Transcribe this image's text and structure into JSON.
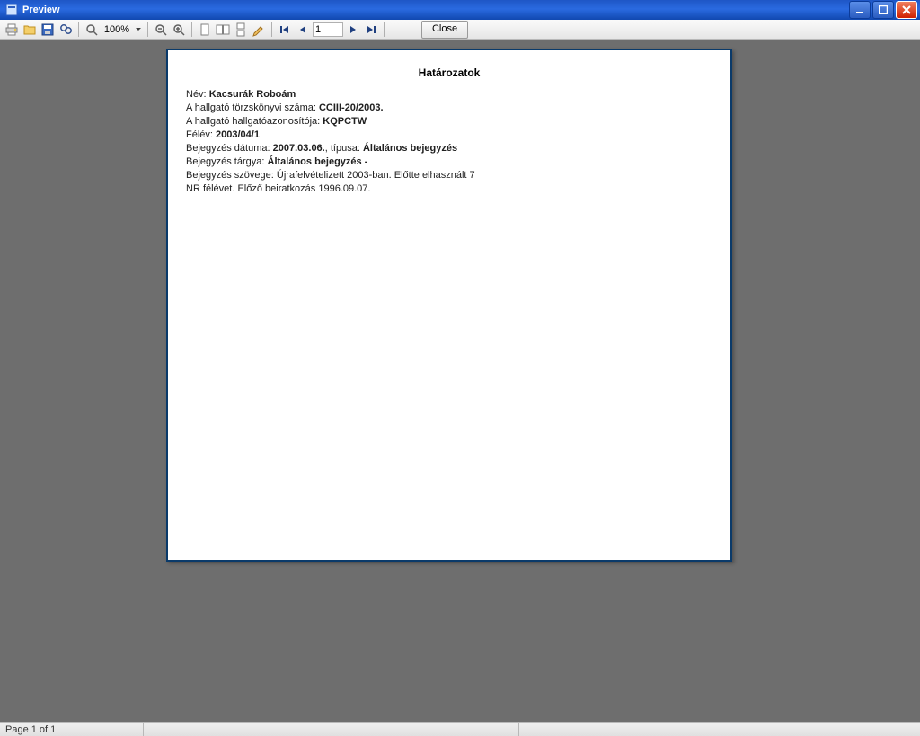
{
  "window": {
    "title": "Preview"
  },
  "toolbar": {
    "zoom_text": "100%",
    "page_input": "1",
    "close_label": "Close"
  },
  "document": {
    "heading": "Határozatok",
    "name_label": "Név:",
    "name_value": "Kacsurák Roboám",
    "reg_label": "A hallgató törzskönyvi száma:",
    "reg_value": "CCIII-20/2003.",
    "studentid_label": "A hallgató hallgatóazonosítója:",
    "studentid_value": "KQPCTW",
    "term_label": "Félév:",
    "term_value": "2003/04/1",
    "entrydate_label": "Bejegyzés dátuma:",
    "entrydate_value": "2007.03.06.",
    "type_label": ", típusa:",
    "type_value": "Általános bejegyzés",
    "subject_label": "Bejegyzés tárgya:",
    "subject_value": "Általános bejegyzés -",
    "body_label": "Bejegyzés szövege:",
    "body_line1": "Újrafelvételizett 2003-ban. Előtte elhasznált 7",
    "body_line2": "NR félévet. Előző beiratkozás 1996.09.07."
  },
  "status": {
    "page_info": "Page 1 of 1"
  }
}
